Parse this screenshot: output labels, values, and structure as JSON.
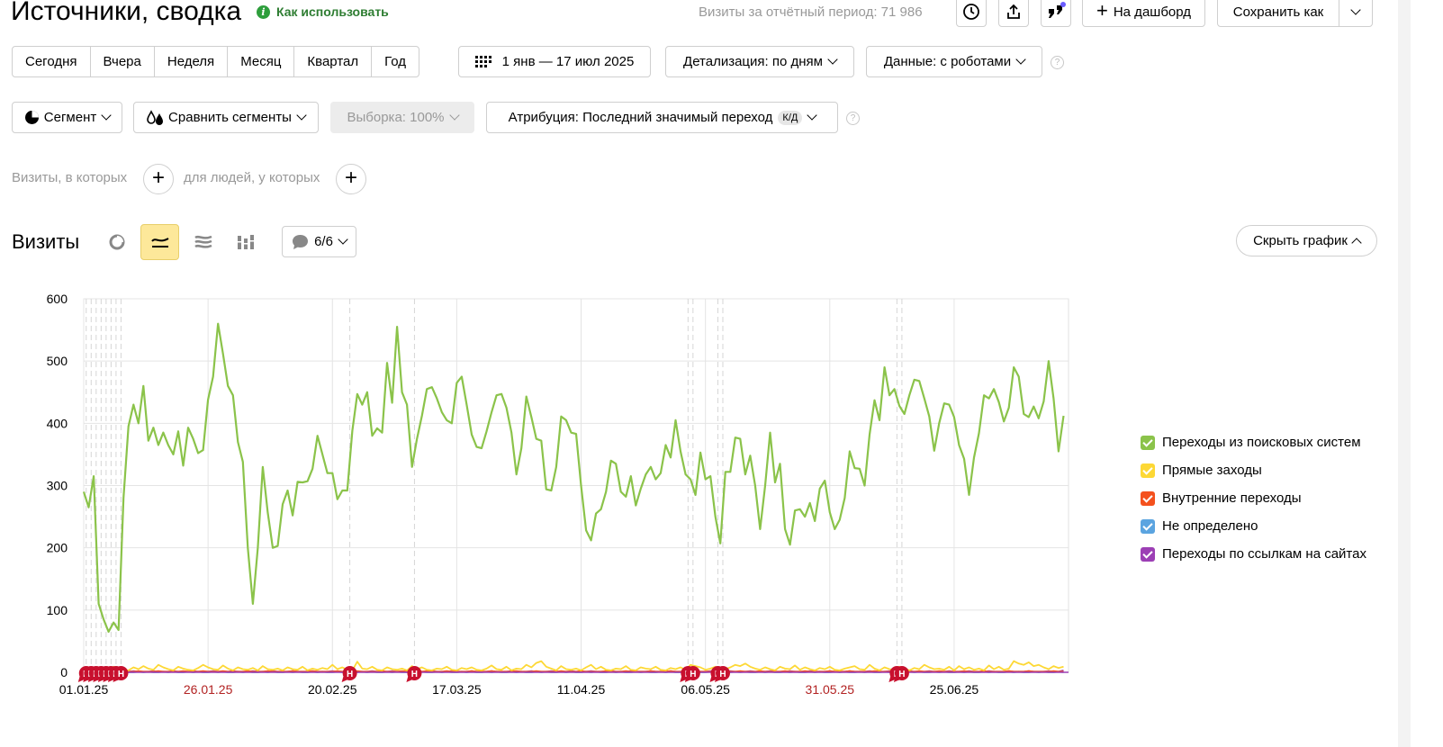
{
  "header": {
    "title": "Источники, сводка",
    "how_to_use": "Как использовать",
    "visits_summary": "Визиты за отчётный период: 71 986",
    "dashboard_label": "На дашборд",
    "save_as_label": "Сохранить как"
  },
  "periods": [
    "Сегодня",
    "Вчера",
    "Неделя",
    "Месяц",
    "Квартал",
    "Год"
  ],
  "date_range": "1 янв — 17 июл 2025",
  "detail_label": "Детализация: по дням",
  "data_label": "Данные: с роботами",
  "segment_label": "Сегмент",
  "compare_label": "Сравнить сегменты",
  "sample_label": "Выборка: 100%",
  "attribution_label": "Атрибуция: Последний значимый переход",
  "attribution_badge": "К/Д",
  "filter": {
    "visits_where": "Визиты, в которых",
    "people_where": "для людей, у которых"
  },
  "chart_header": {
    "title": "Визиты",
    "annotations_count": "6/6",
    "hide_chart": "Скрыть график"
  },
  "colors": {
    "search": "#8bc34a",
    "direct": "#fdd835",
    "internal": "#f4511e",
    "undefined": "#5ba4e0",
    "links": "#9c3fb5",
    "holiday": "#c8102e"
  },
  "chart_data": {
    "type": "line",
    "ylim": [
      0,
      600
    ],
    "yticks": [
      0,
      100,
      200,
      300,
      400,
      500,
      600
    ],
    "xticks": [
      {
        "label": "01.01.25",
        "holiday": false
      },
      {
        "label": "26.01.25",
        "holiday": true
      },
      {
        "label": "20.02.25",
        "holiday": false
      },
      {
        "label": "17.03.25",
        "holiday": false
      },
      {
        "label": "11.04.25",
        "holiday": false
      },
      {
        "label": "06.05.25",
        "holiday": false
      },
      {
        "label": "31.05.25",
        "holiday": true
      },
      {
        "label": "25.06.25",
        "holiday": false
      }
    ],
    "xtick_days": [
      0,
      25,
      50,
      75,
      100,
      125,
      150,
      175
    ],
    "total_days": 198,
    "holiday_marker_label": "Н",
    "holiday_marker_days": [
      0,
      1,
      2,
      3,
      4,
      5,
      6,
      7,
      53,
      66,
      121,
      122,
      127,
      128,
      163,
      164
    ],
    "series": [
      {
        "name": "Переходы из поисковых систем",
        "color": "#8bc34a",
        "values": [
          290,
          265,
          315,
          110,
          85,
          65,
          80,
          68,
          280,
          395,
          430,
          400,
          460,
          372,
          393,
          365,
          385,
          365,
          350,
          387,
          332,
          393,
          375,
          352,
          357,
          438,
          475,
          560,
          512,
          460,
          445,
          370,
          338,
          200,
          110,
          200,
          330,
          257,
          200,
          203,
          270,
          292,
          252,
          306,
          305,
          307,
          327,
          380,
          350,
          320,
          320,
          278,
          292,
          292,
          388,
          447,
          430,
          450,
          380,
          392,
          385,
          497,
          433,
          555,
          450,
          430,
          330,
          375,
          412,
          455,
          458,
          440,
          418,
          405,
          400,
          465,
          475,
          430,
          382,
          362,
          360,
          387,
          418,
          445,
          447,
          425,
          385,
          318,
          360,
          443,
          410,
          375,
          372,
          294,
          292,
          330,
          411,
          405,
          385,
          383,
          300,
          228,
          212,
          255,
          262,
          290,
          340,
          335,
          290,
          282,
          315,
          268,
          295,
          318,
          330,
          310,
          320,
          365,
          345,
          405,
          355,
          318,
          310,
          285,
          353,
          310,
          315,
          250,
          207,
          322,
          322,
          377,
          375,
          318,
          348,
          300,
          230,
          300,
          385,
          305,
          335,
          230,
          205,
          260,
          262,
          250,
          272,
          243,
          295,
          308,
          257,
          230,
          245,
          280,
          355,
          328,
          327,
          300,
          382,
          437,
          405,
          490,
          445,
          455,
          428,
          415,
          445,
          470,
          468,
          440,
          411,
          356,
          400,
          432,
          430,
          410,
          365,
          343,
          285,
          345,
          384,
          445,
          440,
          455,
          434,
          403,
          425,
          490,
          475,
          415,
          410,
          427,
          408,
          435,
          500,
          440,
          355,
          412
        ]
      },
      {
        "name": "Прямые заходы",
        "color": "#fdd835",
        "values": [
          3,
          5,
          4,
          8,
          3,
          5,
          9,
          6,
          4,
          3,
          8,
          5,
          10,
          6,
          4,
          12,
          8,
          5,
          3,
          9,
          6,
          4,
          3,
          7,
          12,
          8,
          5,
          4,
          11,
          6,
          3,
          8,
          5,
          4,
          7,
          3,
          10,
          5,
          4,
          6,
          3,
          8,
          5,
          4,
          9,
          3,
          6,
          4,
          7,
          5,
          12,
          5,
          8,
          4,
          3,
          17,
          6,
          5,
          9,
          4,
          3,
          8,
          5,
          4,
          6,
          3,
          10,
          5,
          8,
          4,
          3,
          6,
          5,
          9,
          4,
          3,
          7,
          5,
          8,
          4,
          3,
          6,
          11,
          5,
          4,
          9,
          3,
          6,
          5,
          12,
          8,
          15,
          18,
          9,
          6,
          3,
          10,
          5,
          4,
          6,
          3,
          8,
          12,
          5,
          9,
          4,
          3,
          6,
          5,
          10,
          4,
          3,
          8,
          6,
          5,
          9,
          4,
          3,
          7,
          5,
          8,
          4,
          12,
          10,
          8,
          4,
          6,
          9,
          3,
          5,
          8,
          12,
          10,
          14,
          9,
          6,
          4,
          8,
          5,
          3,
          9,
          6,
          5,
          11,
          4,
          8,
          5,
          3,
          7,
          5,
          9,
          4,
          3,
          6,
          8,
          10,
          5,
          4,
          12,
          6,
          3,
          8,
          5,
          4,
          9,
          6,
          3,
          7,
          5,
          12,
          8,
          5,
          6,
          4,
          9,
          3,
          10,
          5,
          8,
          4,
          6,
          3,
          11,
          5,
          9,
          4,
          6,
          18,
          14,
          12,
          16,
          10,
          12,
          8,
          5,
          10,
          7,
          9
        ]
      },
      {
        "name": "Внутренние переходы",
        "color": "#f4511e",
        "values": [
          1,
          2,
          1,
          1,
          2,
          1,
          1,
          2,
          1,
          1,
          1,
          2,
          1,
          1,
          1,
          2,
          1,
          1,
          1,
          1,
          2,
          1,
          1,
          1,
          2,
          1,
          1,
          1,
          2,
          1,
          1,
          1,
          1,
          2,
          1,
          1,
          1,
          2,
          1,
          1,
          1,
          1,
          2,
          1,
          1,
          1,
          2,
          1,
          1,
          1,
          1,
          2,
          1,
          1,
          1,
          2,
          1,
          1,
          1,
          1,
          2,
          1,
          1,
          1,
          2,
          1,
          1,
          1,
          1,
          2,
          1,
          1,
          1,
          2,
          1,
          1,
          1,
          1,
          2,
          1,
          1,
          1,
          2,
          1,
          1,
          1,
          1,
          2,
          1,
          1,
          1,
          2,
          1,
          1,
          1,
          1,
          2,
          1,
          1,
          1,
          2,
          1,
          1,
          1,
          1,
          2,
          1,
          1,
          1,
          2,
          1,
          1,
          1,
          1,
          2,
          1,
          1,
          1,
          2,
          1,
          1,
          1,
          1,
          2,
          1,
          1,
          1,
          2,
          1,
          1,
          1,
          1,
          2,
          1,
          1,
          1,
          2,
          1,
          1,
          1,
          1,
          2,
          1,
          1,
          1,
          2,
          1,
          1,
          1,
          1,
          2,
          1,
          1,
          1,
          2,
          1,
          1,
          1,
          1,
          2,
          1,
          1,
          1,
          2,
          1,
          1,
          1,
          1,
          2,
          1,
          1,
          1,
          2,
          1,
          1,
          1,
          1,
          2,
          1,
          1,
          1,
          2,
          1,
          1,
          1,
          1,
          2,
          1,
          1,
          1,
          2,
          1,
          1,
          1,
          1,
          2,
          1,
          1
        ]
      },
      {
        "name": "Не определено",
        "color": "#5ba4e0",
        "values": [
          0,
          1,
          0,
          1,
          0,
          0,
          1,
          0,
          1,
          0,
          0,
          1,
          0,
          1,
          0,
          0,
          1,
          0,
          1,
          0,
          0,
          1,
          0,
          1,
          0,
          0,
          1,
          0,
          1,
          0,
          0,
          1,
          0,
          1,
          0,
          0,
          1,
          0,
          1,
          0,
          0,
          1,
          0,
          1,
          0,
          0,
          1,
          0,
          1,
          0,
          0,
          1,
          0,
          1,
          0,
          0,
          1,
          0,
          1,
          0,
          0,
          1,
          0,
          1,
          0,
          0,
          1,
          0,
          1,
          0,
          0,
          1,
          0,
          1,
          0,
          0,
          1,
          0,
          1,
          0,
          0,
          1,
          0,
          1,
          0,
          0,
          1,
          0,
          1,
          0,
          0,
          1,
          0,
          1,
          0,
          0,
          1,
          0,
          1,
          0,
          0,
          1,
          0,
          1,
          0,
          0,
          1,
          0,
          1,
          0,
          0,
          1,
          0,
          1,
          0,
          0,
          1,
          0,
          1,
          0,
          0,
          1,
          0,
          1,
          0,
          0,
          1,
          0,
          1,
          0,
          0,
          1,
          0,
          1,
          0,
          0,
          1,
          0,
          1,
          0,
          0,
          1,
          0,
          1,
          0,
          0,
          1,
          0,
          1,
          0,
          0,
          1,
          0,
          1,
          0,
          0,
          1,
          0,
          1,
          0,
          0,
          1,
          0,
          1,
          0,
          0,
          1,
          0,
          1,
          0,
          0,
          1,
          0,
          1,
          0,
          0,
          1,
          0,
          1,
          0,
          0,
          1,
          0,
          1,
          0,
          0,
          1,
          0,
          1,
          0,
          0,
          1,
          0,
          1,
          0,
          0,
          1,
          0
        ]
      },
      {
        "name": "Переходы по ссылкам на сайтах",
        "color": "#9c3fb5",
        "values": [
          1,
          1,
          2,
          1,
          1,
          1,
          2,
          1,
          1,
          1,
          2,
          1,
          1,
          1,
          2,
          1,
          1,
          1,
          2,
          1,
          1,
          1,
          2,
          1,
          1,
          1,
          2,
          1,
          1,
          1,
          2,
          1,
          1,
          1,
          2,
          1,
          1,
          1,
          2,
          1,
          1,
          1,
          2,
          1,
          1,
          1,
          2,
          1,
          1,
          1,
          2,
          1,
          1,
          1,
          2,
          1,
          1,
          1,
          2,
          1,
          1,
          1,
          2,
          1,
          1,
          1,
          2,
          1,
          1,
          1,
          2,
          1,
          1,
          1,
          2,
          1,
          1,
          1,
          2,
          1,
          1,
          1,
          2,
          1,
          1,
          1,
          2,
          1,
          1,
          1,
          2,
          1,
          1,
          1,
          2,
          1,
          1,
          1,
          2,
          1,
          1,
          1,
          2,
          1,
          1,
          1,
          2,
          1,
          1,
          1,
          2,
          1,
          1,
          1,
          2,
          1,
          1,
          1,
          2,
          1,
          1,
          1,
          2,
          1,
          1,
          1,
          2,
          1,
          1,
          1,
          2,
          1,
          1,
          1,
          2,
          1,
          1,
          1,
          2,
          1,
          1,
          1,
          2,
          1,
          1,
          1,
          2,
          1,
          1,
          1,
          2,
          1,
          1,
          1,
          2,
          1,
          1,
          1,
          2,
          1,
          1,
          1,
          2,
          1,
          1,
          1,
          2,
          1,
          1,
          1,
          2,
          1,
          1,
          1,
          2,
          1,
          1,
          1,
          2,
          1,
          1,
          1,
          2,
          1,
          1,
          1,
          2,
          1,
          1,
          1,
          2,
          1,
          1,
          1,
          2,
          1,
          1,
          3
        ]
      }
    ]
  }
}
